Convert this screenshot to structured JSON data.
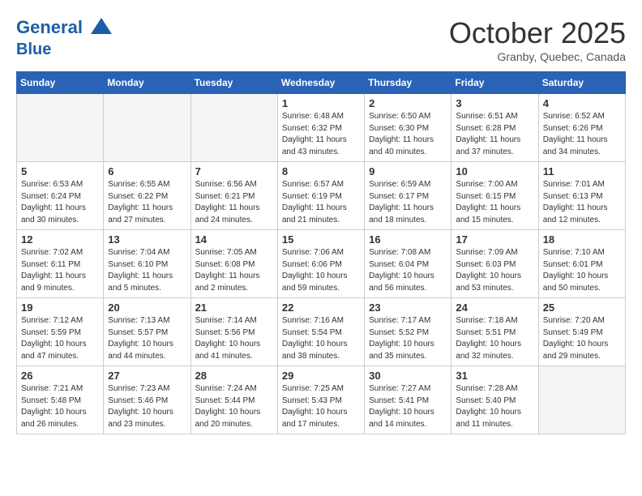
{
  "header": {
    "logo_line1": "General",
    "logo_line2": "Blue",
    "month": "October 2025",
    "location": "Granby, Quebec, Canada"
  },
  "weekdays": [
    "Sunday",
    "Monday",
    "Tuesday",
    "Wednesday",
    "Thursday",
    "Friday",
    "Saturday"
  ],
  "weeks": [
    [
      {
        "day": "",
        "info": ""
      },
      {
        "day": "",
        "info": ""
      },
      {
        "day": "",
        "info": ""
      },
      {
        "day": "1",
        "info": "Sunrise: 6:48 AM\nSunset: 6:32 PM\nDaylight: 11 hours\nand 43 minutes."
      },
      {
        "day": "2",
        "info": "Sunrise: 6:50 AM\nSunset: 6:30 PM\nDaylight: 11 hours\nand 40 minutes."
      },
      {
        "day": "3",
        "info": "Sunrise: 6:51 AM\nSunset: 6:28 PM\nDaylight: 11 hours\nand 37 minutes."
      },
      {
        "day": "4",
        "info": "Sunrise: 6:52 AM\nSunset: 6:26 PM\nDaylight: 11 hours\nand 34 minutes."
      }
    ],
    [
      {
        "day": "5",
        "info": "Sunrise: 6:53 AM\nSunset: 6:24 PM\nDaylight: 11 hours\nand 30 minutes."
      },
      {
        "day": "6",
        "info": "Sunrise: 6:55 AM\nSunset: 6:22 PM\nDaylight: 11 hours\nand 27 minutes."
      },
      {
        "day": "7",
        "info": "Sunrise: 6:56 AM\nSunset: 6:21 PM\nDaylight: 11 hours\nand 24 minutes."
      },
      {
        "day": "8",
        "info": "Sunrise: 6:57 AM\nSunset: 6:19 PM\nDaylight: 11 hours\nand 21 minutes."
      },
      {
        "day": "9",
        "info": "Sunrise: 6:59 AM\nSunset: 6:17 PM\nDaylight: 11 hours\nand 18 minutes."
      },
      {
        "day": "10",
        "info": "Sunrise: 7:00 AM\nSunset: 6:15 PM\nDaylight: 11 hours\nand 15 minutes."
      },
      {
        "day": "11",
        "info": "Sunrise: 7:01 AM\nSunset: 6:13 PM\nDaylight: 11 hours\nand 12 minutes."
      }
    ],
    [
      {
        "day": "12",
        "info": "Sunrise: 7:02 AM\nSunset: 6:11 PM\nDaylight: 11 hours\nand 9 minutes."
      },
      {
        "day": "13",
        "info": "Sunrise: 7:04 AM\nSunset: 6:10 PM\nDaylight: 11 hours\nand 5 minutes."
      },
      {
        "day": "14",
        "info": "Sunrise: 7:05 AM\nSunset: 6:08 PM\nDaylight: 11 hours\nand 2 minutes."
      },
      {
        "day": "15",
        "info": "Sunrise: 7:06 AM\nSunset: 6:06 PM\nDaylight: 10 hours\nand 59 minutes."
      },
      {
        "day": "16",
        "info": "Sunrise: 7:08 AM\nSunset: 6:04 PM\nDaylight: 10 hours\nand 56 minutes."
      },
      {
        "day": "17",
        "info": "Sunrise: 7:09 AM\nSunset: 6:03 PM\nDaylight: 10 hours\nand 53 minutes."
      },
      {
        "day": "18",
        "info": "Sunrise: 7:10 AM\nSunset: 6:01 PM\nDaylight: 10 hours\nand 50 minutes."
      }
    ],
    [
      {
        "day": "19",
        "info": "Sunrise: 7:12 AM\nSunset: 5:59 PM\nDaylight: 10 hours\nand 47 minutes."
      },
      {
        "day": "20",
        "info": "Sunrise: 7:13 AM\nSunset: 5:57 PM\nDaylight: 10 hours\nand 44 minutes."
      },
      {
        "day": "21",
        "info": "Sunrise: 7:14 AM\nSunset: 5:56 PM\nDaylight: 10 hours\nand 41 minutes."
      },
      {
        "day": "22",
        "info": "Sunrise: 7:16 AM\nSunset: 5:54 PM\nDaylight: 10 hours\nand 38 minutes."
      },
      {
        "day": "23",
        "info": "Sunrise: 7:17 AM\nSunset: 5:52 PM\nDaylight: 10 hours\nand 35 minutes."
      },
      {
        "day": "24",
        "info": "Sunrise: 7:18 AM\nSunset: 5:51 PM\nDaylight: 10 hours\nand 32 minutes."
      },
      {
        "day": "25",
        "info": "Sunrise: 7:20 AM\nSunset: 5:49 PM\nDaylight: 10 hours\nand 29 minutes."
      }
    ],
    [
      {
        "day": "26",
        "info": "Sunrise: 7:21 AM\nSunset: 5:48 PM\nDaylight: 10 hours\nand 26 minutes."
      },
      {
        "day": "27",
        "info": "Sunrise: 7:23 AM\nSunset: 5:46 PM\nDaylight: 10 hours\nand 23 minutes."
      },
      {
        "day": "28",
        "info": "Sunrise: 7:24 AM\nSunset: 5:44 PM\nDaylight: 10 hours\nand 20 minutes."
      },
      {
        "day": "29",
        "info": "Sunrise: 7:25 AM\nSunset: 5:43 PM\nDaylight: 10 hours\nand 17 minutes."
      },
      {
        "day": "30",
        "info": "Sunrise: 7:27 AM\nSunset: 5:41 PM\nDaylight: 10 hours\nand 14 minutes."
      },
      {
        "day": "31",
        "info": "Sunrise: 7:28 AM\nSunset: 5:40 PM\nDaylight: 10 hours\nand 11 minutes."
      },
      {
        "day": "",
        "info": ""
      }
    ]
  ]
}
